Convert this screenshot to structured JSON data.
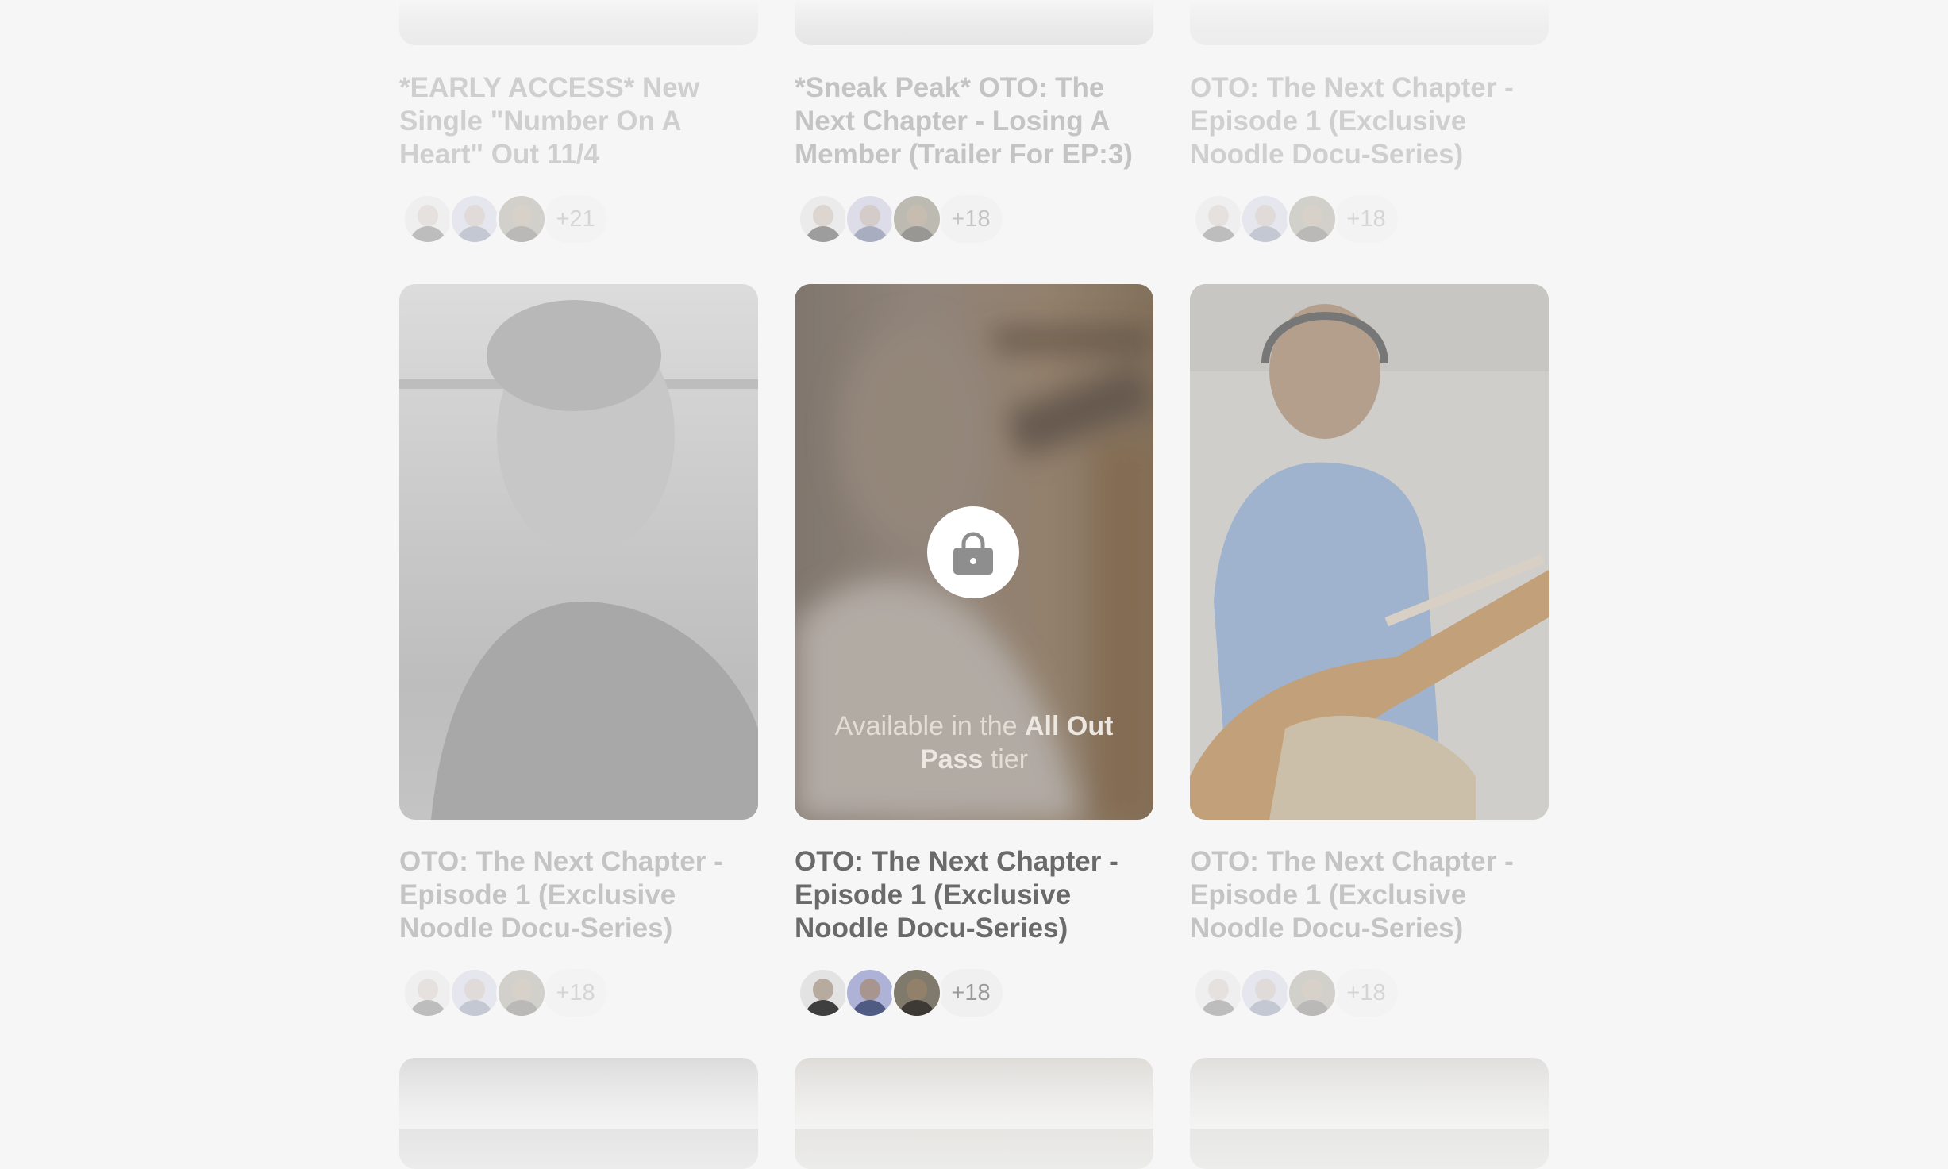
{
  "rows": [
    {
      "row": "top",
      "cards": [
        {
          "title": "*EARLY ACCESS* New Single \"Number On A Heart\" Out 11/4",
          "count": "+21"
        },
        {
          "title": "*Sneak Peak* OTO: The Next Chapter - Losing A Member (Trailer For EP:3)",
          "count": "+18"
        },
        {
          "title": "OTO: The Next Chapter - Episode 1 (Exclusive Noodle Docu-Series)",
          "count": "+18"
        }
      ]
    },
    {
      "row": "middle",
      "cards": [
        {
          "title": "OTO: The Next Chapter - Episode 1 (Exclusive Noodle Docu-Series)",
          "count": "+18"
        },
        {
          "title": "OTO: The Next Chapter - Episode 1 (Exclusive Noodle Docu-Series)",
          "count": "+18",
          "locked": true,
          "lock_text_before": "Available in the ",
          "lock_tier": "All Out Pass",
          "lock_text_after": " tier"
        },
        {
          "title": "OTO: The Next Chapter - Episode 1 (Exclusive Noodle Docu-Series)",
          "count": "+18"
        }
      ]
    }
  ],
  "icons": {
    "lock": "lock-icon",
    "avatar": "avatar"
  },
  "colors": {
    "background": "#f6f6f6",
    "title_active": "#6a6a6a",
    "title_faded": "#cfcfcf",
    "lock_circle": "#ffffff"
  }
}
